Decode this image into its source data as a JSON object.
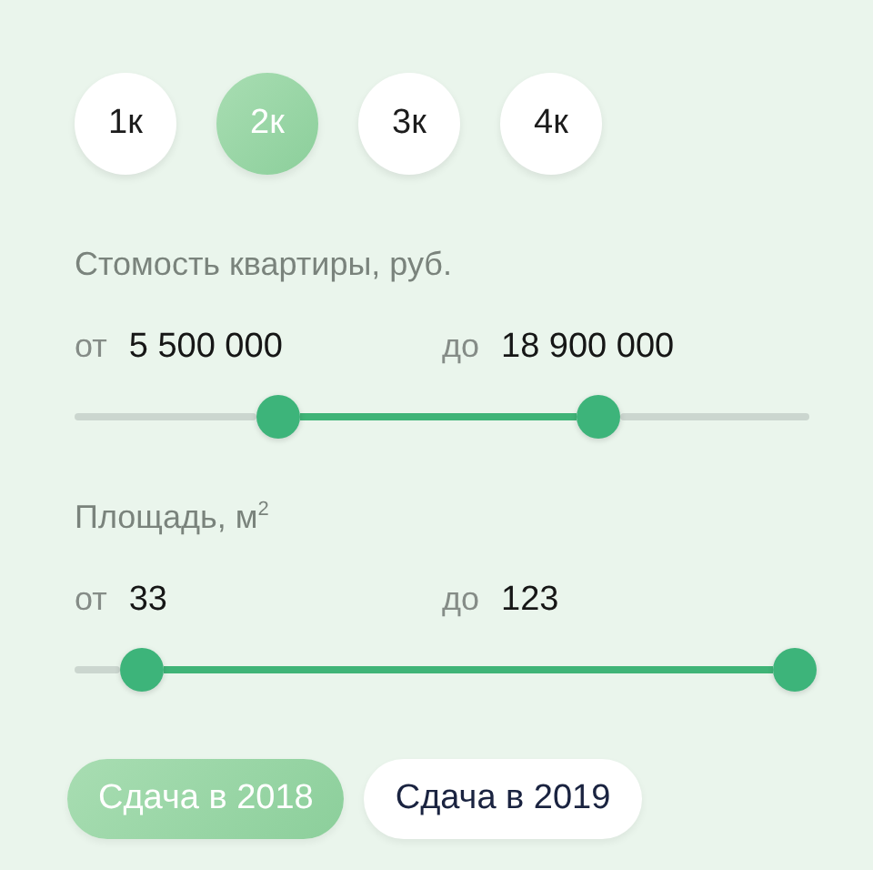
{
  "rooms": [
    {
      "label": "1к",
      "selected": false
    },
    {
      "label": "2к",
      "selected": true
    },
    {
      "label": "3к",
      "selected": false
    },
    {
      "label": "4к",
      "selected": false
    }
  ],
  "filters": [
    {
      "title": "Стомость квартиры, руб.",
      "from_label": "от",
      "from_value": "5 500 000",
      "to_label": "до",
      "to_value": "18 900 000",
      "thumbs": [
        {
          "level": 0.277
        },
        {
          "level": 0.713
        }
      ]
    },
    {
      "title": "Площадь, м$^{2}$",
      "from_label": "от",
      "from_value": "33",
      "to_label": "до",
      "to_value": "123",
      "thumbs": [
        {
          "level": 0.092
        },
        {
          "level": 0.98
        }
      ]
    }
  ],
  "years": [
    {
      "label": "Сдача в 2018",
      "selected": true
    },
    {
      "label": "Сдача в 2019",
      "selected": false
    }
  ]
}
